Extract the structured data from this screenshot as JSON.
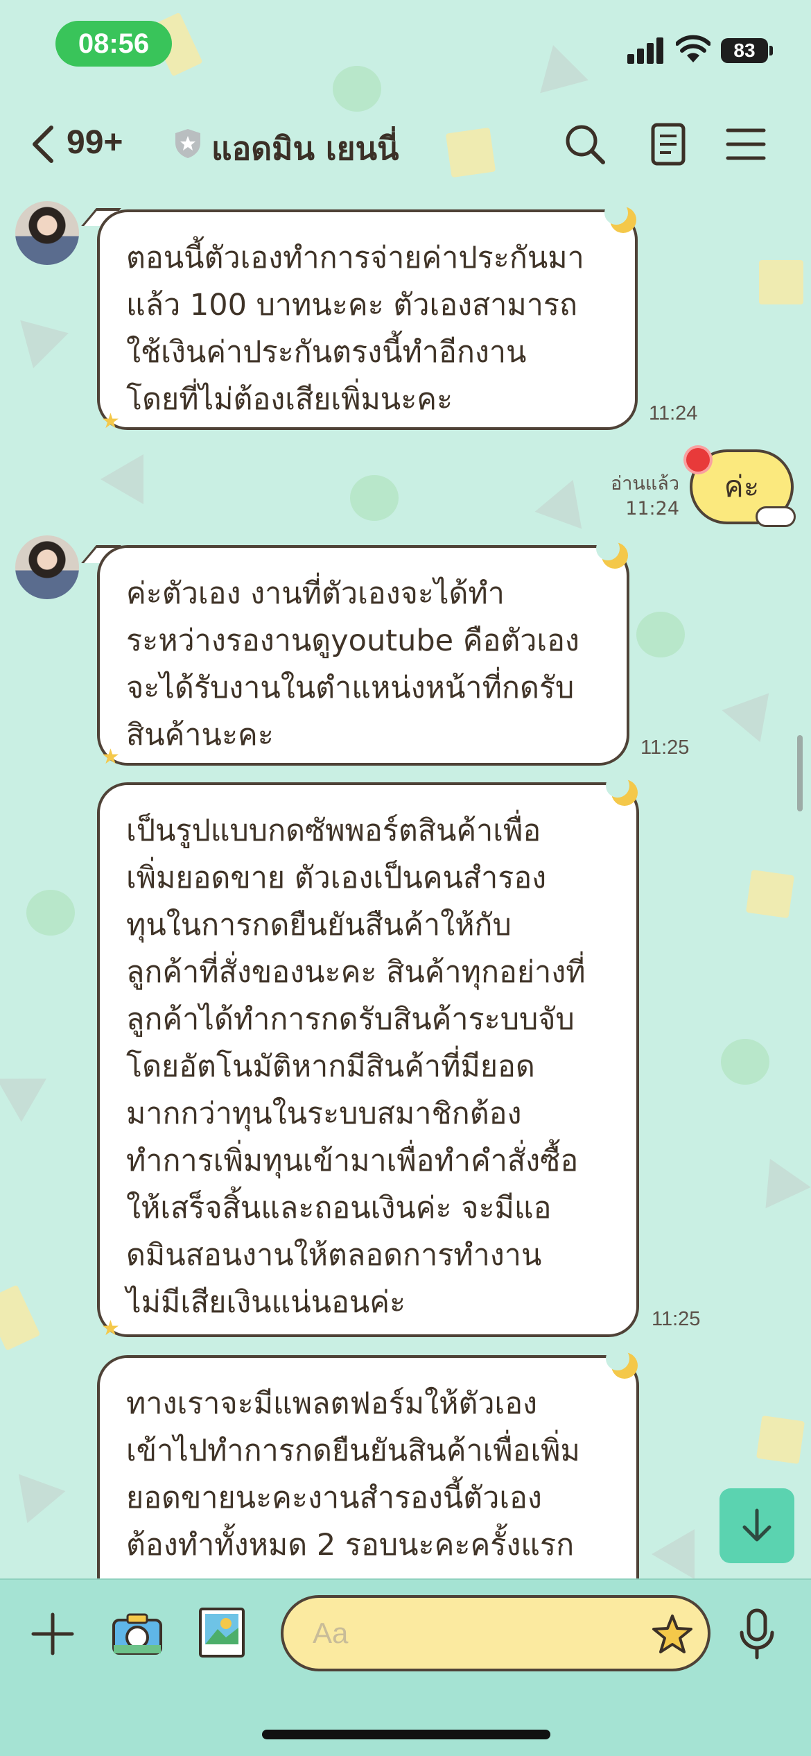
{
  "status": {
    "time": "08:56",
    "battery": "83"
  },
  "header": {
    "unread_count": "99+",
    "chat_name": "แอดมิน เยนนี่",
    "icons": [
      "back-chevron-icon",
      "shield-icon",
      "search-icon",
      "notes-icon",
      "menu-icon"
    ]
  },
  "messages": [
    {
      "text": "ตอนนี้ตัวเองทำการจ่ายค่าประกันมา\nแล้ว 100 บาทนะคะ ตัวเองสามารถ\nใช้เงินค่าประกันตรงนี้ทำอีกงาน\nโดยที่ไม่ต้องเสียเพิ่มนะคะ",
      "time": "11:24"
    },
    {
      "text": "ค่ะตัวเอง งานที่ตัวเองจะได้ทำ\nระหว่างรองานดูyoutube คือตัวเอง\nจะได้รับงานในตำแหน่งหน้าที่กดรับ\nสินค้านะคะ",
      "time": "11:25"
    },
    {
      "text": "เป็นรูปแบบกดซัพพอร์ตสินค้าเพื่อ\nเพิ่มยอดขาย ตัวเองเป็นคนสำรอง\nทุนในการกดยืนยันสืนค้าให้กับ\nลูกค้าที่สั่งของนะคะ สินค้าทุกอย่างที่\nลูกค้าได้ทำการกดรับสินค้าระบบจับ\nโดยอัตโนมัติหากมีสินค้าที่มียอด\nมากกว่าทุนในระบบสมาชิกต้อง\nทำการเพิ่มทุนเข้ามาเพื่อทำคำสั่งซื้อ\nให้เสร็จสิ้นและถอนเงินค่ะ จะมีแอ\nดมินสอนงานให้ตลอดการทำงาน\nไม่มีเสียเงินแน่นอนค่ะ",
      "time": "11:25"
    },
    {
      "text": "ทางเราจะมีแพลตฟอร์มให้ตัวเอง\nเข้าไปทำการกดยืนยันสินค้าเพื่อเพิ่ม\nยอดขายนะคะงานสำรองนี้ตัวเอง\nต้องทำทั้งหมด 2 รอบนะคะครั้งแรก",
      "time": ""
    }
  ],
  "my_message": {
    "text": "ค่ะ",
    "read_label": "อ่านแล้ว",
    "time": "11:24"
  },
  "input": {
    "placeholder": "Aa"
  },
  "colors": {
    "background": "#c9efe3",
    "bubble_border": "#4f4237",
    "my_bubble": "#fbe97e",
    "input_bar": "#a5e3d3",
    "time_pill": "#39c45a"
  }
}
